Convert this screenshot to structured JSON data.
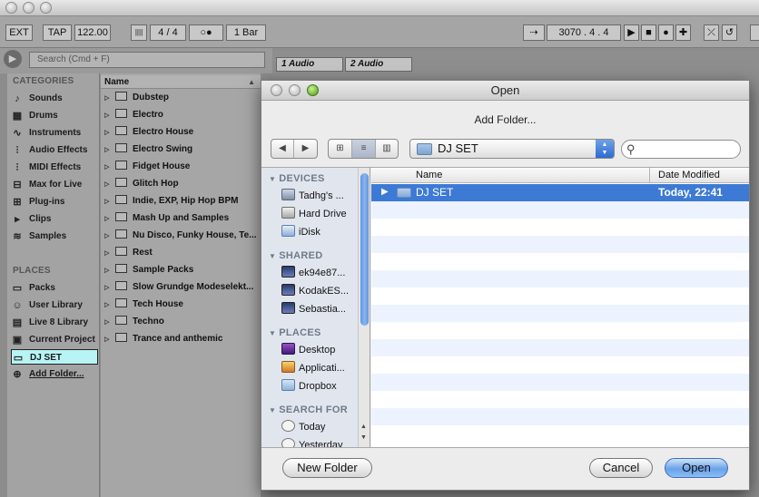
{
  "ableton": {
    "toolbar": {
      "ext": "EXT",
      "tap": "TAP",
      "tempo": "122.00",
      "meter_bars": "||||",
      "time_sig": "4  /  4",
      "metronome": "○●",
      "quantize": "1 Bar",
      "arrangement_position": "3070 .  4 .  4"
    },
    "search_placeholder": "Search (Cmd + F)",
    "categories_heading": "CATEGORIES",
    "categories": [
      {
        "label": "Sounds",
        "icon": "note-icon"
      },
      {
        "label": "Drums",
        "icon": "drum-grid-icon"
      },
      {
        "label": "Instruments",
        "icon": "waveform-icon"
      },
      {
        "label": "Audio Effects",
        "icon": "audio-effect-icon"
      },
      {
        "label": "MIDI Effects",
        "icon": "midi-effect-icon"
      },
      {
        "label": "Max for Live",
        "icon": "max-icon"
      },
      {
        "label": "Plug-ins",
        "icon": "plugin-icon"
      },
      {
        "label": "Clips",
        "icon": "clip-icon"
      },
      {
        "label": "Samples",
        "icon": "sample-wave-icon"
      }
    ],
    "places_heading": "PLACES",
    "places": [
      {
        "label": "Packs",
        "icon": "packs-icon"
      },
      {
        "label": "User Library",
        "icon": "user-icon"
      },
      {
        "label": "Live 8 Library",
        "icon": "library-icon"
      },
      {
        "label": "Current Project",
        "icon": "project-icon"
      },
      {
        "label": "DJ SET",
        "icon": "folder-icon"
      },
      {
        "label": "Add Folder...",
        "icon": "add-icon"
      }
    ],
    "name_column": "Name",
    "folders": [
      "Dubstep",
      "Electro",
      "Electro House",
      "Electro Swing",
      "Fidget House",
      "Glitch Hop",
      "Indie, EXP, Hip Hop BPM",
      "Mash Up and Samples",
      "Nu Disco, Funky House, Te...",
      "Rest",
      "Sample Packs",
      "Slow Grundge Modeselekt...",
      "Tech House",
      "Techno",
      "Trance and anthemic"
    ],
    "tracks": [
      "1 Audio",
      "2 Audio"
    ]
  },
  "dialog": {
    "title": "Open",
    "subtitle": "Add Folder...",
    "nav_back": "◀",
    "nav_forward": "▶",
    "path": "DJ SET",
    "search_value": "",
    "sidebar": {
      "devices_heading": "DEVICES",
      "devices": [
        "Tadhg's ...",
        "Hard Drive",
        "iDisk"
      ],
      "shared_heading": "SHARED",
      "shared": [
        "ek94e87...",
        "KodakES...",
        "Sebastia..."
      ],
      "places_heading": "PLACES",
      "places": [
        "Desktop",
        "Applicati...",
        "Dropbox"
      ],
      "search_heading": "SEARCH FOR",
      "search_for": [
        "Today",
        "Yesterday"
      ]
    },
    "columns": {
      "name": "Name",
      "date": "Date Modified"
    },
    "rows": [
      {
        "name": "DJ SET",
        "date": "Today, 22:41"
      }
    ],
    "buttons": {
      "new_folder": "New Folder",
      "cancel": "Cancel",
      "open": "Open"
    },
    "colors": {
      "selection": "#3d7ad5",
      "alt_row": "#edf3fe",
      "scroll_thumb": "#5f95e0"
    }
  }
}
